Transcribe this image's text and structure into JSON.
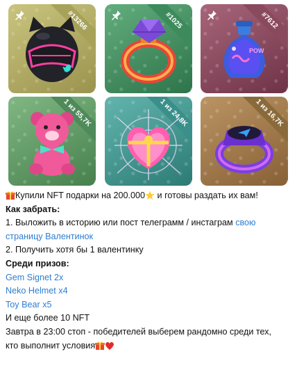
{
  "tiles": [
    {
      "badge": "#13266",
      "ribbon_color": "#b8b35a",
      "bg_from": "#c7c27a",
      "bg_to": "#9c9550",
      "icon": "neko-helmet-icon"
    },
    {
      "badge": "#1025",
      "ribbon_color": "#3a8a5a",
      "bg_from": "#5ea878",
      "bg_to": "#2f7a4d",
      "icon": "gem-ring-icon"
    },
    {
      "badge": "#7612",
      "ribbon_color": "#8a4a5e",
      "bg_from": "#a66479",
      "bg_to": "#6f3448",
      "icon": "love-potion-icon"
    },
    {
      "badge": "1 из 55,7K",
      "ribbon_color": "#4f8a5a",
      "bg_from": "#7cb27e",
      "bg_to": "#4a8550",
      "icon": "toy-bear-icon"
    },
    {
      "badge": "1 из 24,8K",
      "ribbon_color": "#3a8f8a",
      "bg_from": "#5eb3ab",
      "bg_to": "#2f8079",
      "icon": "heart-box-icon"
    },
    {
      "badge": "1 из 16,7K",
      "ribbon_color": "#8a6a3a",
      "bg_from": "#b89060",
      "bg_to": "#8a6238",
      "icon": "signet-ring-icon"
    }
  ],
  "message": {
    "intro_text": "Купили NFT подарки на 200.000",
    "intro_text_2": " и готовы раздать их вам!",
    "how_title": "Как забрать:",
    "step1_text": "1. Выложить в историю или пост телеграмм / инстаграм ",
    "step1_link_a": "свою",
    "step1_link_b": "страницу Валентинок",
    "step2_text": "2. Получить хотя бы 1 валентинку",
    "prizes_title": "Среди призов:",
    "prize1": "Gem Signet 2x",
    "prize2": "Neko Helmet x4",
    "prize3": "Toy Bear x5",
    "prize_more": "И еще более 10 NFT",
    "footer_1": "Завтра в 23:00 стоп - победителей выберем рандомно среди тех,",
    "footer_2": "кто выполнит условия"
  },
  "colors": {
    "link": "#2e7dd1",
    "text": "#111111"
  }
}
